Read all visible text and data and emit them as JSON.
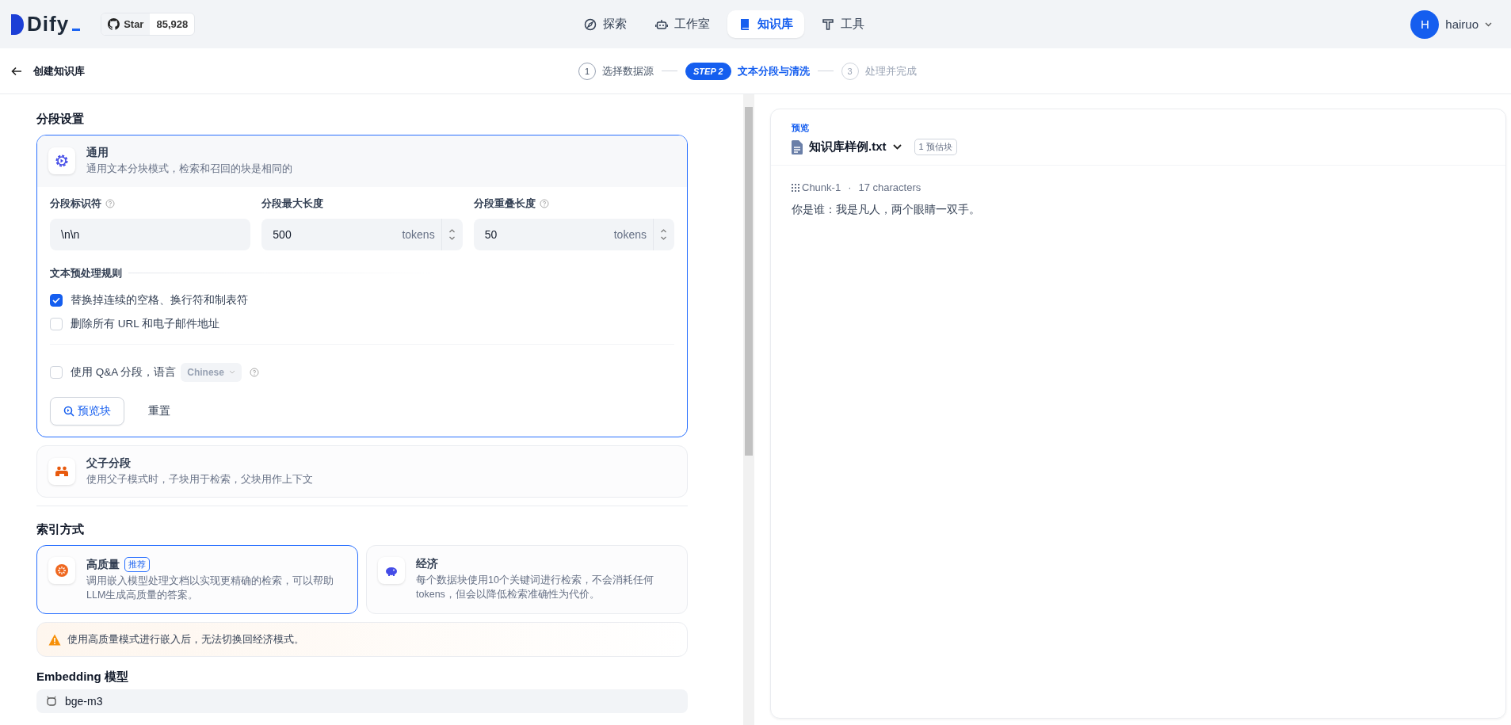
{
  "header": {
    "logo": "Dify",
    "github": {
      "label": "Star",
      "count": "85,928"
    },
    "nav": [
      {
        "label": "探索",
        "selected": false
      },
      {
        "label": "工作室",
        "selected": false
      },
      {
        "label": "知识库",
        "selected": true
      },
      {
        "label": "工具",
        "selected": false
      }
    ],
    "user": {
      "initial": "H",
      "name": "hairuo"
    }
  },
  "subheader": {
    "title": "创建知识库",
    "steps": [
      {
        "badge": "1",
        "label": "选择数据源",
        "kind": "done"
      },
      {
        "badge": "STEP 2",
        "label": "文本分段与清洗",
        "kind": "active"
      },
      {
        "badge": "3",
        "label": "处理并完成",
        "kind": "pending"
      }
    ]
  },
  "segment": {
    "title": "分段设置",
    "modes": [
      {
        "name": "通用",
        "desc": "通用文本分块模式，检索和召回的块是相同的",
        "selected": true
      },
      {
        "name": "父子分段",
        "desc": "使用父子模式时，子块用于检索，父块用作上下文",
        "selected": false
      }
    ],
    "fields": [
      {
        "label": "分段标识符",
        "help": true,
        "value": "\\n\\n"
      },
      {
        "label": "分段最大长度",
        "help": false,
        "value": "500",
        "unit": "tokens"
      },
      {
        "label": "分段重叠长度",
        "help": true,
        "value": "50",
        "unit": "tokens"
      }
    ],
    "rules_title": "文本预处理规则",
    "rules": [
      {
        "label": "替换掉连续的空格、换行符和制表符",
        "checked": true
      },
      {
        "label": "删除所有 URL 和电子邮件地址",
        "checked": false
      }
    ],
    "qa": {
      "label": "使用 Q&A 分段，语言",
      "checked": false,
      "language": "Chinese"
    },
    "preview_button": "预览块",
    "reset_button": "重置"
  },
  "index": {
    "title": "索引方式",
    "options": [
      {
        "name": "高质量",
        "tag": "推荐",
        "desc": "调用嵌入模型处理文档以实现更精确的检索，可以帮助LLM生成高质量的答案。",
        "selected": true
      },
      {
        "name": "经济",
        "desc": "每个数据块使用10个关键词进行检索，不会消耗任何tokens，但会以降低检索准确性为代价。",
        "selected": false
      }
    ],
    "warning": "使用高质量模式进行嵌入后，无法切换回经济模式。"
  },
  "embedding": {
    "title": "Embedding 模型",
    "value": "bge-m3"
  },
  "preview": {
    "label": "预览",
    "file": "知识库样例.txt",
    "estimate": "1 预估块",
    "chunks": [
      {
        "name": "Chunk-1",
        "separator": "·",
        "count": "17 characters",
        "text": "你是谁：我是凡人，两个眼睛一双手。"
      }
    ]
  }
}
